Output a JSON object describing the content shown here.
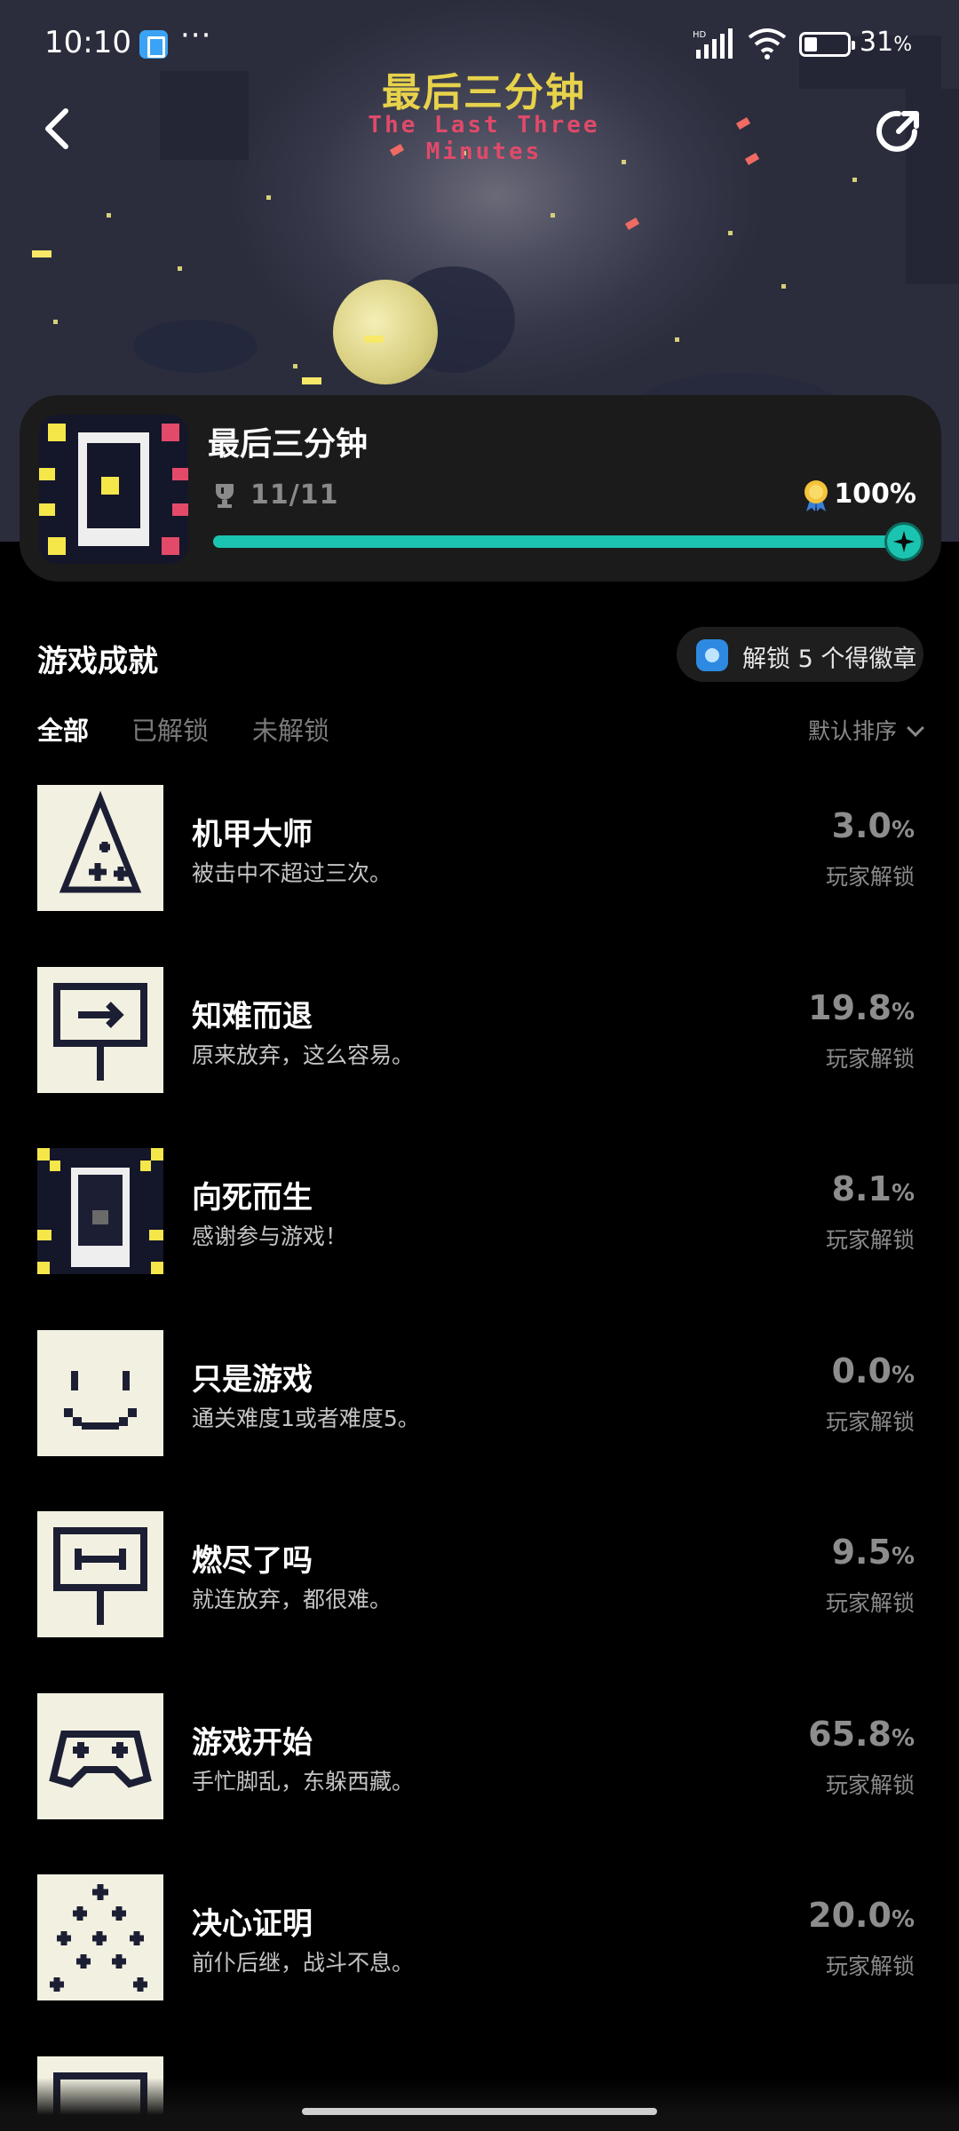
{
  "status_bar": {
    "time": "10:10",
    "more": "···",
    "network": "HD",
    "battery_pct": "31",
    "battery_unit": "%"
  },
  "hero": {
    "art_title_cn": "最后三分钟",
    "art_title_en": "The Last Three Minutes"
  },
  "game": {
    "title": "最后三分钟",
    "achievements_count": "11/11",
    "completion": "100%",
    "progress": 1.0
  },
  "section": {
    "title": "游戏成就",
    "badge_hint": "解锁 5 个得徽章"
  },
  "tabs": [
    {
      "label": "全部",
      "active": true
    },
    {
      "label": "已解锁",
      "active": false
    },
    {
      "label": "未解锁",
      "active": false
    }
  ],
  "sort": {
    "label": "默认排序"
  },
  "achievements": [
    {
      "title": "机甲大师",
      "desc": "被击中不超过三次。",
      "pct": "3.0",
      "unit": "%",
      "sub": "玩家解锁",
      "icon": "triangle-plus-icon"
    },
    {
      "title": "知难而退",
      "desc": "原来放弃，这么容易。",
      "pct": "19.8",
      "unit": "%",
      "sub": "玩家解锁",
      "icon": "sign-arrow-icon"
    },
    {
      "title": "向死而生",
      "desc": "感谢参与游戏！",
      "pct": "8.1",
      "unit": "%",
      "sub": "玩家解锁",
      "icon": "dark-figure-icon"
    },
    {
      "title": "只是游戏",
      "desc": "通关难度1或者难度5。",
      "pct": "0.0",
      "unit": "%",
      "sub": "玩家解锁",
      "icon": "smiley-icon"
    },
    {
      "title": "燃尽了吗",
      "desc": "就连放弃，都很难。",
      "pct": "9.5",
      "unit": "%",
      "sub": "玩家解锁",
      "icon": "sign-dumbbell-icon"
    },
    {
      "title": "游戏开始",
      "desc": "手忙脚乱，东躲西藏。",
      "pct": "65.8",
      "unit": "%",
      "sub": "玩家解锁",
      "icon": "gamepad-icon"
    },
    {
      "title": "决心证明",
      "desc": "前仆后继，战斗不息。",
      "pct": "20.0",
      "unit": "%",
      "sub": "玩家解锁",
      "icon": "many-plus-icon"
    }
  ],
  "colors": {
    "accent": "#1bc4b0",
    "background": "#000000",
    "card": "#1b1b1b",
    "icon_bg": "#f2f1e1",
    "icon_fg": "#1c1f34"
  }
}
